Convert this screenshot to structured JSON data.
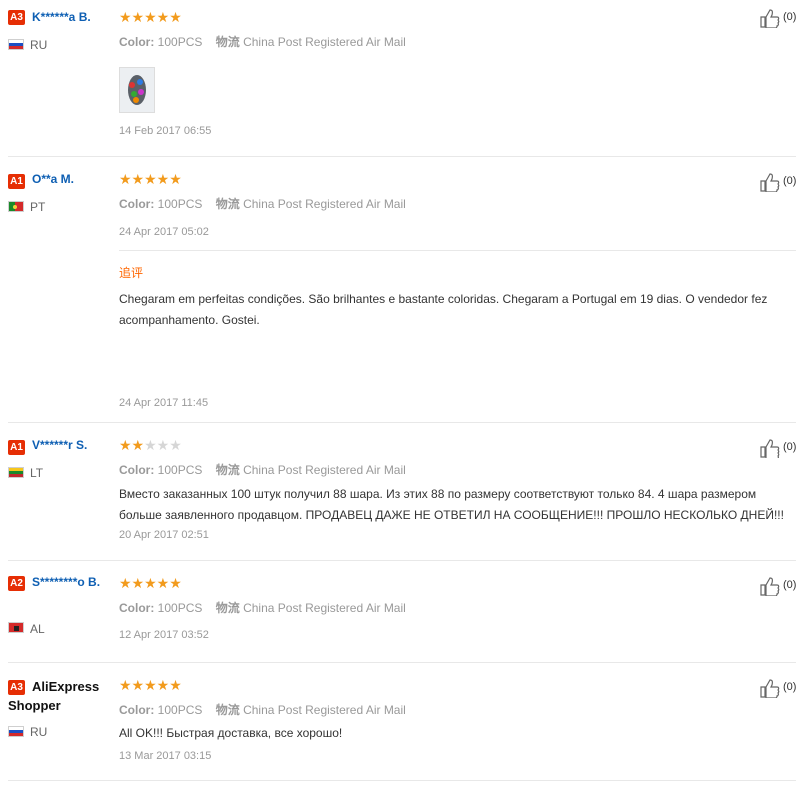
{
  "color_label": "Color:",
  "color_value": "100PCS",
  "shipping_label": "物流",
  "shipping_value": "China Post Registered Air Mail",
  "reviews": [
    {
      "badge": "A3",
      "name": "K******a B.",
      "country": "RU",
      "rating": 5,
      "date": "14 Feb 2017 06:55",
      "likes": "(0)",
      "has_photo": true
    },
    {
      "badge": "A1",
      "name": "O**a M.",
      "country": "PT",
      "rating": 5,
      "date": "24 Apr 2017 05:02",
      "likes": "(0)",
      "additional_label": "追评",
      "additional_text": "Chegaram em perfeitas condições. São brilhantes e bastante coloridas. Chegaram a Portugal em 19 dias. O vendedor fez acompanhamento. Gostei.",
      "additional_date": "24 Apr 2017 11:45"
    },
    {
      "badge": "A1",
      "name": "V******r S.",
      "country": "LT",
      "rating": 2,
      "date": "20 Apr 2017 02:51",
      "likes": "(0)",
      "text": "Вместо заказанных 100 штук получил 88 шара. Из этих 88 по размеру соответствуют только 84. 4 шара размером больше заявленного продавцом. ПРОДАВЕЦ ДАЖЕ НЕ ОТВЕТИЛ НА СООБЩЕНИЕ!!! ПРОШЛО НЕСКОЛЬКО ДНЕЙ!!!"
    },
    {
      "badge": "A2",
      "name": "S********o B.",
      "country": "AL",
      "rating": 5,
      "date": "12 Apr 2017 03:52",
      "likes": "(0)"
    },
    {
      "badge": "A3",
      "name": "AliExpress Shopper",
      "country": "RU",
      "rating": 5,
      "date": "13 Mar 2017 03:15",
      "likes": "(0)",
      "text": "All OK!!! Быстрая доставка, все хорошо!"
    }
  ],
  "colors": {
    "badge": "#e62e04",
    "username": "#0e5fb3",
    "star": "#f29b1d",
    "star_empty": "#d6d6d6",
    "additional": "#ff6600"
  },
  "icons": {
    "like": "thumbs-up-icon",
    "photo": "review-photo-thumbnail"
  }
}
